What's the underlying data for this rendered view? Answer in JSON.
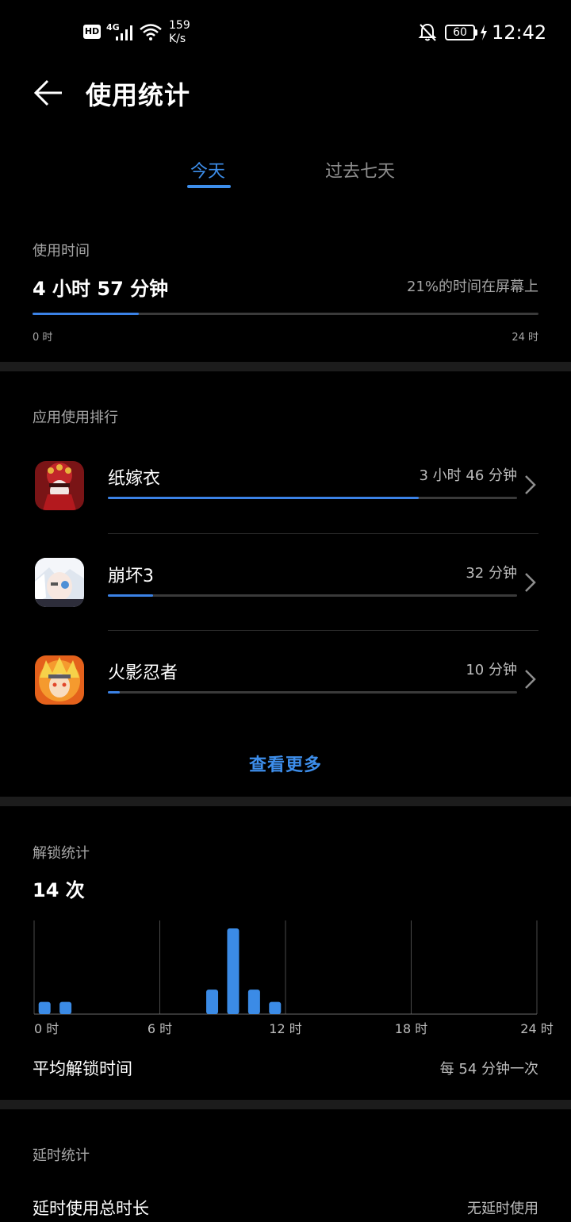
{
  "status_bar": {
    "hd": "HD",
    "network": "4G",
    "speed_value": "159",
    "speed_unit": "K/s",
    "battery": "60",
    "time": "12:42"
  },
  "header": {
    "title": "使用统计",
    "back_icon": "back-arrow-icon"
  },
  "tabs": [
    {
      "label": "今天",
      "active": true
    },
    {
      "label": "过去七天",
      "active": false
    }
  ],
  "usage": {
    "label": "使用时间",
    "total": "4 小时 57 分钟",
    "screen_percent_text": "21%的时间在屏幕上",
    "progress_fraction": 0.21,
    "axis_start": "0 时",
    "axis_end": "24 时"
  },
  "ranking": {
    "label": "应用使用排行",
    "apps": [
      {
        "name": "纸嫁衣",
        "time": "3 小时 46 分钟",
        "fraction": 0.76,
        "icon": "bride-app-icon"
      },
      {
        "name": "崩坏3",
        "time": "32 分钟",
        "fraction": 0.11,
        "icon": "honkai-app-icon"
      },
      {
        "name": "火影忍者",
        "time": "10 分钟",
        "fraction": 0.03,
        "icon": "naruto-app-icon"
      }
    ],
    "more": "查看更多"
  },
  "unlock": {
    "label": "解锁统计",
    "count": "14 次",
    "avg_label": "平均解锁时间",
    "avg_value": "每 54 分钟一次"
  },
  "chart_data": {
    "type": "bar",
    "title": "",
    "xlabel": "",
    "ylabel": "",
    "x_ticks": [
      "0 时",
      "6 时",
      "12 时",
      "18 时",
      "24 时"
    ],
    "xlim": [
      0,
      24
    ],
    "ylim": [
      0,
      7
    ],
    "grid": true,
    "series": [
      {
        "x": [
          0,
          1,
          8,
          9,
          10,
          11
        ],
        "values": [
          1,
          1,
          2,
          7,
          2,
          1
        ]
      }
    ],
    "color": "#3b8be6"
  },
  "delay": {
    "label": "延时统计",
    "row_label": "延时使用总时长",
    "row_value": "无延时使用"
  }
}
